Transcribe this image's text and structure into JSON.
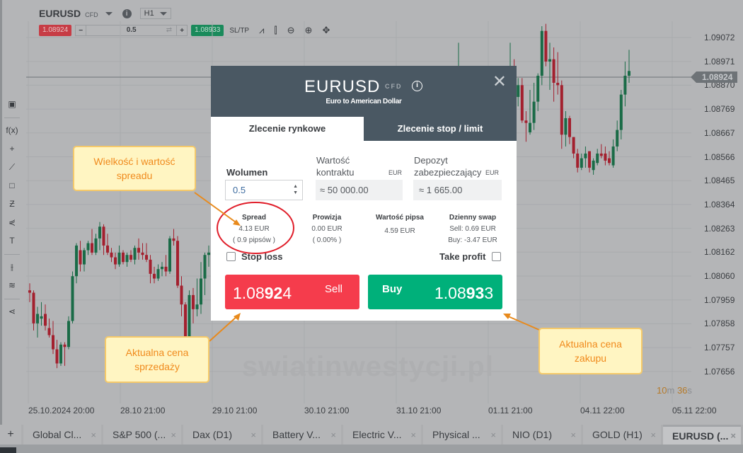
{
  "header": {
    "symbol": "EURUSD",
    "symbol_type": "CFD",
    "info_icon": "info-icon",
    "timeframe": "H1",
    "sell_price": "1.08924",
    "volume": "0.5",
    "buy_price": "1.08933",
    "sltp_label": "SL/TP",
    "tools": [
      "line-chart-icon",
      "candles-icon",
      "zoom-out-icon",
      "zoom-in-icon",
      "move-icon"
    ]
  },
  "toolbar": {
    "items": [
      {
        "icon": "chart-type-icon",
        "glyph": "▣"
      },
      {
        "icon": "indicators-icon",
        "glyph": "f(x)"
      },
      {
        "icon": "crosshair-icon",
        "glyph": "+"
      },
      {
        "icon": "trendline-icon",
        "glyph": "⟋"
      },
      {
        "icon": "rectangle-icon",
        "glyph": "□"
      },
      {
        "icon": "fibonacci-icon",
        "glyph": "Ƶ"
      },
      {
        "icon": "pitchfork-icon",
        "glyph": "⋞"
      },
      {
        "icon": "text-icon",
        "glyph": "T"
      },
      {
        "icon": "compare-icon",
        "glyph": "⫲"
      },
      {
        "icon": "layers-icon",
        "glyph": "≋"
      },
      {
        "icon": "share-icon",
        "glyph": "⋖"
      }
    ]
  },
  "chart": {
    "price_axis": [
      "1.09072",
      "1.08971",
      "1.08870",
      "1.08769",
      "1.08667",
      "1.08566",
      "1.08465",
      "1.08364",
      "1.08263",
      "1.08162",
      "1.08060",
      "1.07959",
      "1.07858",
      "1.07757",
      "1.07656"
    ],
    "current_price": "1.08924",
    "time_axis": [
      "25.10.2024 20:00",
      "28.10 21:00",
      "29.10 21:00",
      "30.10 21:00",
      "31.10 21:00",
      "01.11 21:00",
      "04.11 22:00",
      "05.11 22:00"
    ],
    "countdown_min": "10",
    "countdown_min_unit": "m",
    "countdown_sec": "36",
    "countdown_sec_unit": "s",
    "watermark": "swiatinwestycji.pl",
    "colors": {
      "up": "#1a6b47",
      "down": "#a3202e"
    }
  },
  "tabs": [
    {
      "label": "Global Cl...",
      "active": false
    },
    {
      "label": "S&P 500 (...",
      "active": false
    },
    {
      "label": "Dax (D1)",
      "active": false
    },
    {
      "label": "Battery V...",
      "active": false
    },
    {
      "label": "Electric V...",
      "active": false
    },
    {
      "label": "Physical ...",
      "active": false
    },
    {
      "label": "NIO (D1)",
      "active": false
    },
    {
      "label": "GOLD (H1)",
      "active": false
    },
    {
      "label": "EURUSD (...",
      "active": true
    }
  ],
  "tab_close": "×",
  "tab_add": "+",
  "modal": {
    "title": "EURUSD",
    "type": "CFD",
    "subtitle": "Euro to American Dollar",
    "close": "✕",
    "tab_market": "Zlecenie rynkowe",
    "tab_stop_limit": "Zlecenie stop / limit",
    "volume_label": "Wolumen",
    "volume_value": "0.5",
    "contract_label_1": "Wartość",
    "contract_label_2": "kontraktu",
    "contract_currency": "EUR",
    "contract_value": "≈ 50 000.00",
    "margin_label_1": "Depozyt",
    "margin_label_2": "zabezpieczający",
    "margin_currency": "EUR",
    "margin_value": "≈ 1 665.00",
    "spread_label": "Spread",
    "spread_value": "4.13 EUR",
    "spread_pips": "( 0.9 pipsów )",
    "commission_label": "Prowizja",
    "commission_value": "0.00 EUR",
    "commission_pct": "( 0.00% )",
    "pip_value_label": "Wartość pipsa",
    "pip_value": "4.59 EUR",
    "swap_label": "Dzienny swap",
    "swap_sell": "Sell: 0.69 EUR",
    "swap_buy": "Buy: -3.47 EUR",
    "stop_loss_label": "Stop loss",
    "take_profit_label": "Take profit",
    "sell_label": "Sell",
    "sell_price_a": "1.08",
    "sell_price_b": "92",
    "sell_price_c": "4",
    "buy_label": "Buy",
    "buy_price_a": "1.08",
    "buy_price_b": "93",
    "buy_price_c": "3",
    "colors": {
      "sell": "#f53c4c",
      "buy": "#00b07a",
      "header": "#4a5863"
    }
  },
  "annotations": {
    "spread_note": [
      "Wielkość i wartość",
      "spreadu"
    ],
    "sell_note": [
      "Aktualna cena",
      "sprzedaży"
    ],
    "buy_note": [
      "Aktualna cena",
      "zakupu"
    ],
    "color": "#f08a1c"
  }
}
